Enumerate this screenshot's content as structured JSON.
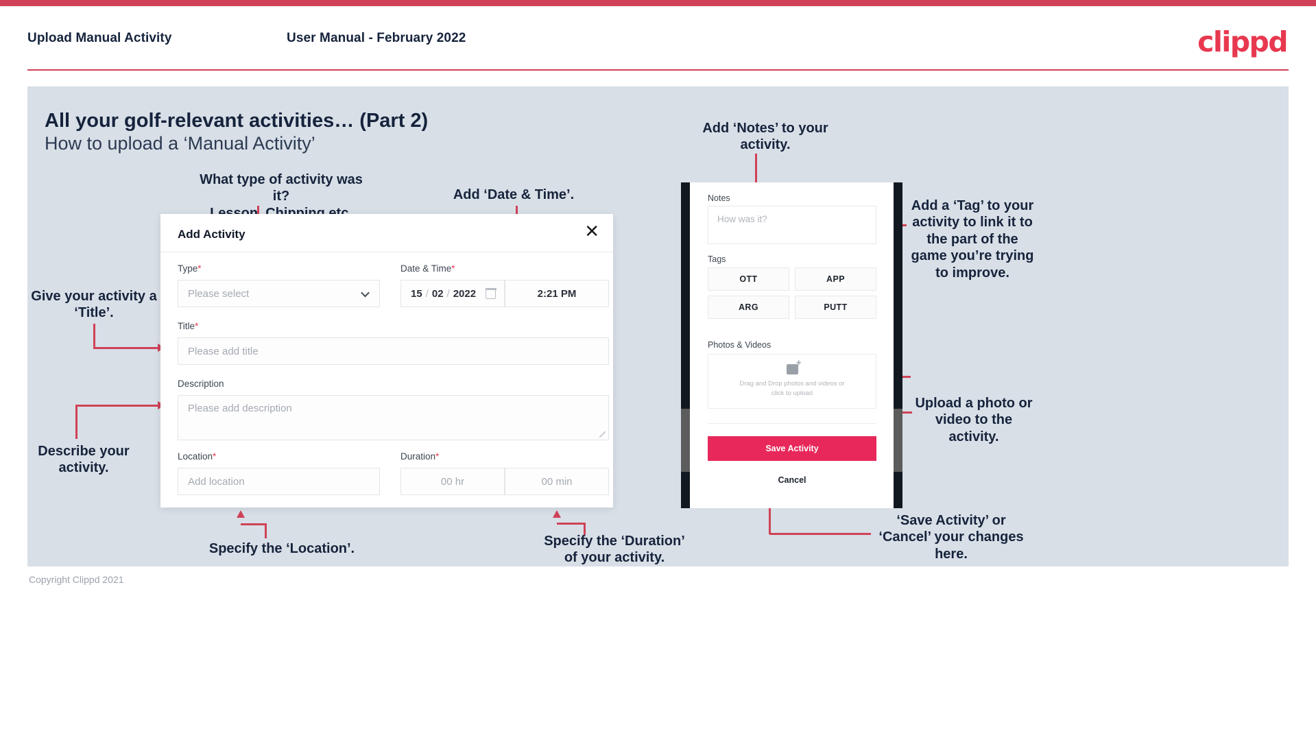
{
  "header": {
    "left_title": "Upload Manual Activity",
    "center_title": "User Manual - February 2022",
    "logo": "clippd"
  },
  "slide": {
    "title": "All your golf-relevant activities… (Part 2)",
    "subtitle": "How to upload a ‘Manual Activity’",
    "footer": "Copyright Clippd 2021"
  },
  "annotations": {
    "type": "What type of activity was it?\nLesson, Chipping etc.",
    "datetime": "Add ‘Date & Time’.",
    "title": "Give your activity a\n‘Title’.",
    "describe": "Describe your\nactivity.",
    "location": "Specify the ‘Location’.",
    "duration": "Specify the ‘Duration’\nof your activity.",
    "notes": "Add ‘Notes’ to your\nactivity.",
    "tags": "Add a ‘Tag’ to your\nactivity to link it to\nthe part of the\ngame you’re trying\nto improve.",
    "upload": "Upload a photo or\nvideo to the activity.",
    "save_cancel": "‘Save Activity’ or\n‘Cancel’ your changes\nhere."
  },
  "dialog": {
    "title": "Add Activity",
    "close_icon": "✕",
    "fields": {
      "type_label": "Type",
      "type_placeholder": "Please select",
      "datetime_label": "Date & Time",
      "date_day": "15",
      "date_month": "02",
      "date_year": "2022",
      "date_sep": "/",
      "time_value": "2:21 PM",
      "title_label": "Title",
      "title_placeholder": "Please add title",
      "description_label": "Description",
      "description_placeholder": "Please add description",
      "location_label": "Location",
      "location_placeholder": "Add location",
      "duration_label": "Duration",
      "duration_hr_placeholder": "00 hr",
      "duration_min_placeholder": "00 min"
    },
    "required_marker": "*"
  },
  "phone": {
    "notes_label": "Notes",
    "notes_placeholder": "How was it?",
    "tags_label": "Tags",
    "tags": [
      "OTT",
      "APP",
      "ARG",
      "PUTT"
    ],
    "photos_label": "Photos & Videos",
    "dropzone_line1": "Drag and Drop photos and videos or",
    "dropzone_line2": "click to upload",
    "save_label": "Save Activity",
    "cancel_label": "Cancel"
  },
  "colors": {
    "brand_pink": "#e8384f",
    "accent_crimson": "#cf4257",
    "slide_bg": "#d8dfe7",
    "text_dark": "#15233c",
    "save_button": "#e8285a"
  }
}
